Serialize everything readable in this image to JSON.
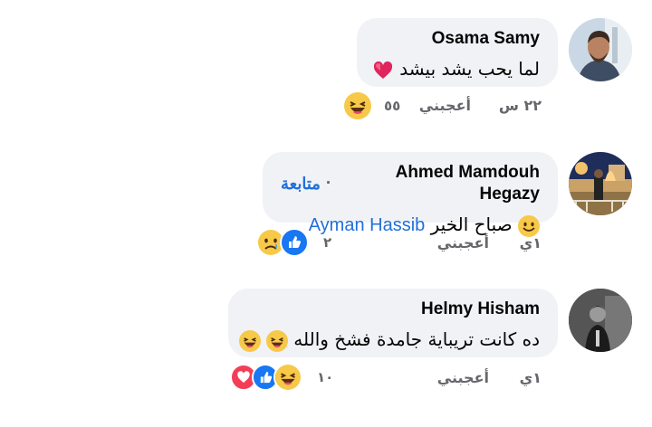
{
  "comments": [
    {
      "author": "Osama Samy",
      "text": "لما يحب يشد بيشد",
      "time": "٢٢ س",
      "like_label": "أعجبني",
      "reaction_count": "٥٥"
    },
    {
      "author": "Ahmed Mamdouh Hegazy",
      "follow_label": "متابعة",
      "text": "صباح الخير",
      "mention": "Ayman Hassib",
      "time": "١ي",
      "like_label": "أعجبني",
      "reaction_count": "٢"
    },
    {
      "author": "Helmy Hisham",
      "text": "ده كانت تريباية جامدة فشخ والله",
      "time": "١ي",
      "like_label": "أعجبني",
      "reaction_count": "١٠"
    }
  ],
  "icons": {
    "heart": "heart-icon",
    "laugh": "laughing-emoji-icon",
    "smile": "smiling-emoji-icon",
    "like": "like-icon",
    "sad": "sad-emoji-icon",
    "love": "love-icon"
  },
  "colors": {
    "bubble": "#f0f2f5",
    "link": "#216fdb",
    "meta": "#65676b",
    "like_blue": "#1877f2",
    "love_red": "#f33e58",
    "emoji_yellow": "#f7c948"
  }
}
